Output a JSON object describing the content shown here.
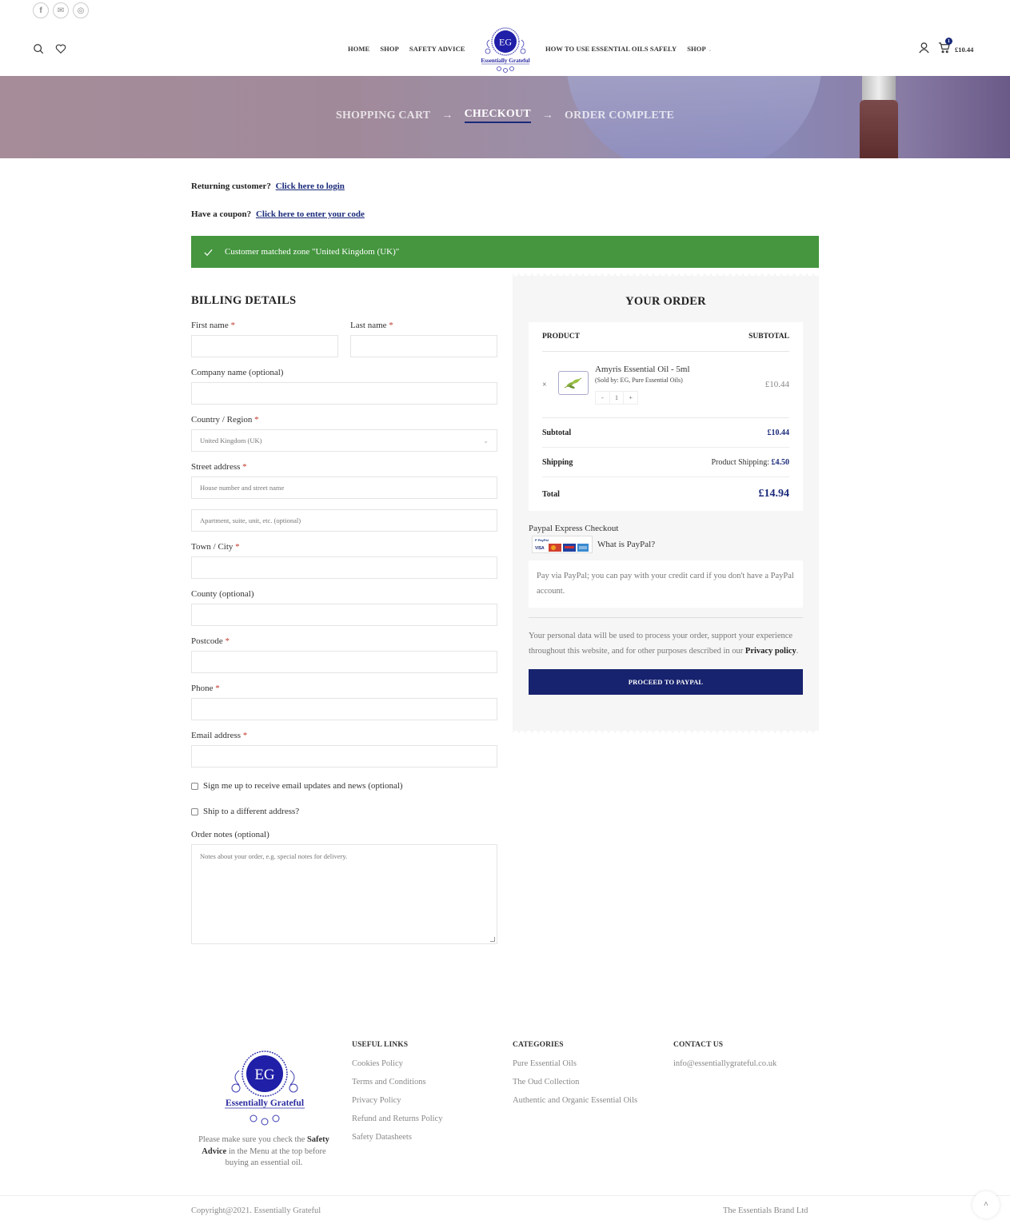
{
  "social": [
    {
      "name": "facebook-icon",
      "glyph": "f"
    },
    {
      "name": "email-icon",
      "glyph": "✉"
    },
    {
      "name": "instagram-icon",
      "glyph": "◎"
    }
  ],
  "header": {
    "nav_left": [
      "HOME",
      "SHOP",
      "SAFETY ADVICE"
    ],
    "nav_right": [
      "HOW TO USE ESSENTIAL OILS SAFELY",
      "SHOP"
    ],
    "logo_initials": "EG",
    "logo_text": "Essentially Grateful",
    "cart_count": "1",
    "cart_total": "£10.44"
  },
  "breadcrumb": {
    "steps": [
      "SHOPPING CART",
      "CHECKOUT",
      "ORDER COMPLETE"
    ],
    "arrow": "→",
    "active_index": 1
  },
  "notices": {
    "returning_text": "Returning customer?",
    "returning_link": "Click here to login",
    "coupon_text": "Have a coupon?",
    "coupon_link": "Click here to enter your code",
    "success_message": "Customer matched zone \"United Kingdom (UK)\"",
    "success_color": "#45963f"
  },
  "billing": {
    "title": "BILLING DETAILS",
    "first_name": {
      "label": "First name",
      "required": "*",
      "value": ""
    },
    "last_name": {
      "label": "Last name",
      "required": "*",
      "value": ""
    },
    "company": {
      "label": "Company name (optional)",
      "value": ""
    },
    "country": {
      "label": "Country / Region",
      "required": "*",
      "value": "United Kingdom (UK)"
    },
    "street": {
      "label": "Street address",
      "required": "*",
      "placeholder1": "House number and street name",
      "placeholder2": "Apartment, suite, unit, etc. (optional)"
    },
    "town": {
      "label": "Town / City",
      "required": "*",
      "value": ""
    },
    "county": {
      "label": "County (optional)",
      "value": ""
    },
    "postcode": {
      "label": "Postcode",
      "required": "*",
      "value": ""
    },
    "phone": {
      "label": "Phone",
      "required": "*",
      "value": ""
    },
    "email": {
      "label": "Email address",
      "required": "*",
      "value": ""
    },
    "signup_label": "Sign me up to receive email updates and news (optional)",
    "ship_diff_label": "Ship to a different address?",
    "notes": {
      "label": "Order notes (optional)",
      "placeholder": "Notes about your order, e.g. special notes for delivery."
    }
  },
  "order": {
    "title": "YOUR ORDER",
    "col_product": "PRODUCT",
    "col_subtotal": "SUBTOTAL",
    "item": {
      "remove": "×",
      "name": "Amyris Essential Oil - 5ml",
      "seller": "(Sold by: EG, Pure Essential Oils)",
      "qty_minus": "-",
      "qty": "1",
      "qty_plus": "+",
      "price": "£10.44"
    },
    "subtotal_label": "Subtotal",
    "subtotal_value": "£10.44",
    "shipping_label": "Shipping",
    "shipping_method": "Product Shipping:",
    "shipping_value": "£4.50",
    "total_label": "Total",
    "total_value": "£14.94",
    "payment_title": "Paypal Express Checkout",
    "what_is_paypal": "What is PayPal?",
    "payment_desc": "Pay via PayPal; you can pay with your credit card if you don't have a PayPal account.",
    "privacy_text": "Your personal data will be used to process your order, support your experience throughout this website, and for other purposes described in our",
    "privacy_link": "Privacy policy",
    "privacy_end": ".",
    "proceed_label": "PROCEED TO PAYPAL",
    "accent_color": "#17236e"
  },
  "footer": {
    "logo_initials": "EG",
    "logo_text": "Essentially Grateful",
    "about_pre": "Please make sure you check the",
    "about_bold": "Safety Advice",
    "about_post": "in the Menu at the top before buying an essential oil.",
    "useful_title": "USEFUL LINKS",
    "useful_links": [
      "Cookies Policy",
      "Terms and Conditions",
      "Privacy Policy",
      "Refund and Returns Policy",
      "Safety Datasheets"
    ],
    "categories_title": "CATEGORIES",
    "categories": [
      "Pure Essential Oils",
      "The Oud Collection",
      "Authentic and Organic Essential Oils"
    ],
    "contact_title": "CONTACT US",
    "contact_email": "info@essentiallygrateful.co.uk",
    "copyright": "Copyright@2021. Essentially Grateful",
    "brand": "The Essentials Brand Ltd",
    "to_top": "^"
  }
}
